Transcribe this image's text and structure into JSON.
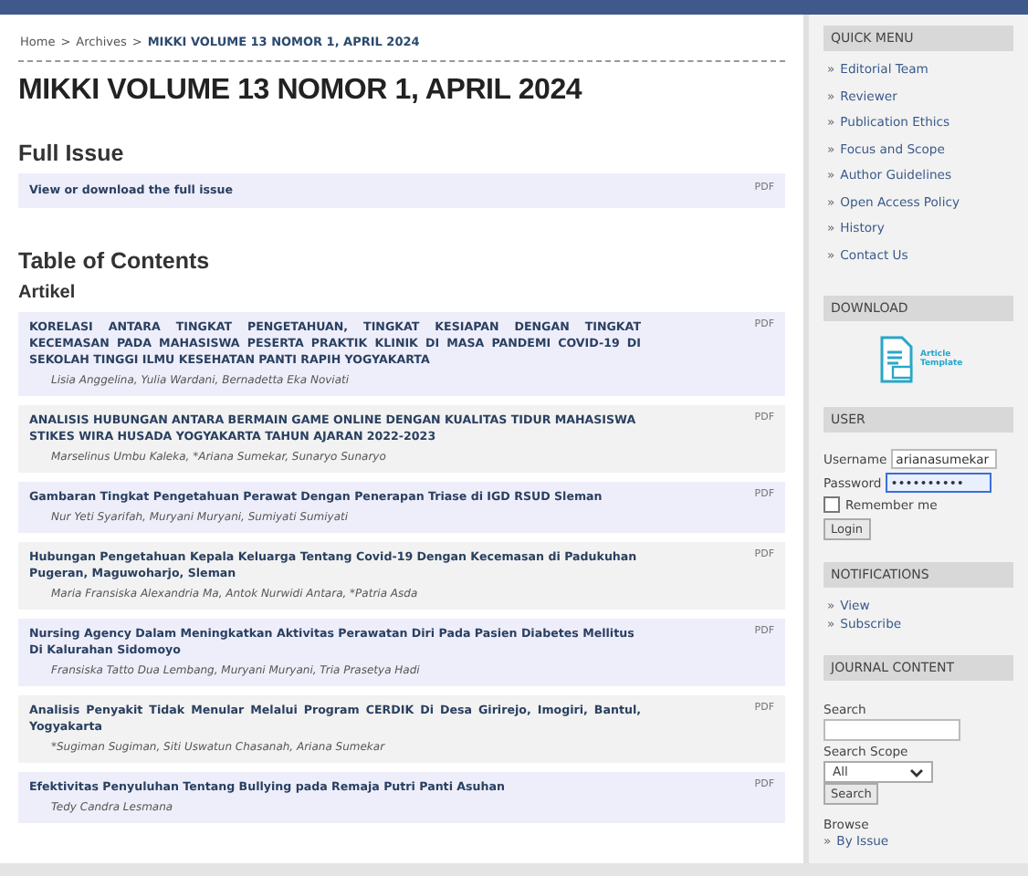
{
  "breadcrumb": [
    {
      "label": "Home",
      "current": false
    },
    {
      "label": "Archives",
      "current": false
    },
    {
      "label": "MIKKI VOLUME 13 NOMOR 1, APRIL 2024",
      "current": true
    }
  ],
  "breadcrumb_separator": ">",
  "page_title": "MIKKI VOLUME 13 NOMOR 1, APRIL 2024",
  "full_issue": {
    "heading": "Full Issue",
    "label": "View or download the full issue",
    "file": "PDF"
  },
  "toc": {
    "heading": "Table of Contents",
    "section": "Artikel",
    "articles": [
      {
        "title": "KORELASI ANTARA TINGKAT PENGETAHUAN, TINGKAT KESIAPAN DENGAN TINGKAT KECEMASAN PADA MAHASISWA PESERTA PRAKTIK KLINIK DI MASA PANDEMI COVID-19 DI SEKOLAH TINGGI ILMU KESEHATAN PANTI RAPIH YOGYAKARTA",
        "authors": "Lisia Anggelina, Yulia Wardani, Bernadetta Eka Noviati",
        "file": "PDF"
      },
      {
        "title": "ANALISIS HUBUNGAN ANTARA BERMAIN GAME ONLINE DENGAN KUALITAS TIDUR MAHASISWA STIKES WIRA HUSADA YOGYAKARTA TAHUN AJARAN 2022-2023",
        "authors": "Marselinus Umbu Kaleka, *Ariana Sumekar, Sunaryo Sunaryo",
        "file": "PDF"
      },
      {
        "title": "Gambaran Tingkat Pengetahuan Perawat Dengan Penerapan Triase di IGD RSUD Sleman",
        "authors": "Nur Yeti Syarifah, Muryani Muryani, Sumiyati Sumiyati",
        "file": "PDF"
      },
      {
        "title": "Hubungan Pengetahuan Kepala Keluarga Tentang Covid-19 Dengan Kecemasan di Padukuhan Pugeran, Maguwoharjo, Sleman",
        "authors": "Maria Fransiska Alexandria Ma, Antok Nurwidi Antara, *Patria Asda",
        "file": "PDF"
      },
      {
        "title": "Nursing Agency Dalam Meningkatkan Aktivitas Perawatan Diri Pada Pasien Diabetes Mellitus Di Kalurahan Sidomoyo",
        "authors": "Fransiska Tatto Dua Lembang, Muryani Muryani, Tria Prasetya Hadi",
        "file": "PDF"
      },
      {
        "title": "Analisis Penyakit Tidak Menular Melalui Program CERDIK Di Desa Girirejo, Imogiri, Bantul, Yogyakarta",
        "authors": "*Sugiman Sugiman, Siti Uswatun Chasanah, Ariana Sumekar",
        "file": "PDF"
      },
      {
        "title": "Efektivitas Penyuluhan Tentang Bullying pada Remaja Putri Panti Asuhan",
        "authors": "Tedy Candra Lesmana",
        "file": "PDF"
      }
    ]
  },
  "sidebar": {
    "quick_menu": {
      "heading": "QUICK MENU",
      "bullet": "»",
      "items": [
        "Editorial Team",
        "Reviewer",
        "Publication Ethics",
        "Focus and Scope",
        "Author Guidelines",
        "Open Access Policy",
        "History",
        "Contact Us"
      ]
    },
    "download": {
      "heading": "DOWNLOAD",
      "link": "Article Template"
    },
    "user": {
      "heading": "USER",
      "username_label": "Username",
      "username": "arianasumekar",
      "password_label": "Password",
      "password": "••••••••••",
      "remember_label": "Remember me",
      "remember": false,
      "login": "Login"
    },
    "notifications": {
      "heading": "NOTIFICATIONS",
      "items": [
        "View",
        "Subscribe"
      ]
    },
    "journal_content": {
      "heading": "JOURNAL CONTENT",
      "search_label": "Search",
      "scope_label": "Search Scope",
      "scope": "All",
      "search_button": "Search",
      "browse_label": "Browse",
      "browse_items": [
        "By Issue"
      ]
    }
  }
}
